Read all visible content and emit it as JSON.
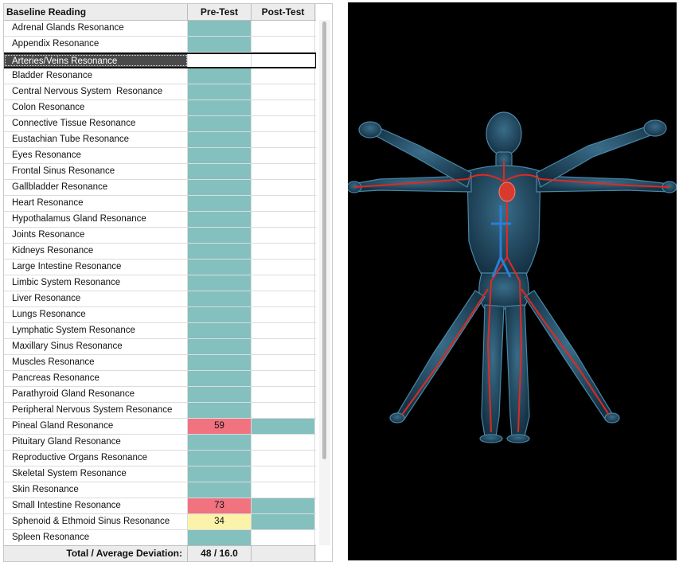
{
  "table": {
    "headers": {
      "name": "Baseline Reading",
      "pre": "Pre-Test",
      "post": "Post-Test"
    },
    "colors": {
      "teal": "#83c0be",
      "red": "#f0737f",
      "yellow": "#fbf3a9",
      "empty": "#ffffff"
    },
    "rows": [
      {
        "name": "Adrenal Glands Resonance",
        "pre": "",
        "pre_color": "teal",
        "post": "",
        "post_color": "empty"
      },
      {
        "name": "Appendix Resonance",
        "pre": "",
        "pre_color": "teal",
        "post": "",
        "post_color": "empty"
      },
      {
        "name": "Arteries/Veins Resonance",
        "pre": "",
        "pre_color": "teal",
        "post": "",
        "post_color": "empty",
        "selected": true
      },
      {
        "name": "Bladder Resonance",
        "pre": "",
        "pre_color": "teal",
        "post": "",
        "post_color": "empty"
      },
      {
        "name": "Central Nervous System  Resonance",
        "pre": "",
        "pre_color": "teal",
        "post": "",
        "post_color": "empty"
      },
      {
        "name": "Colon Resonance",
        "pre": "",
        "pre_color": "teal",
        "post": "",
        "post_color": "empty"
      },
      {
        "name": "Connective Tissue Resonance",
        "pre": "",
        "pre_color": "teal",
        "post": "",
        "post_color": "empty"
      },
      {
        "name": "Eustachian Tube Resonance",
        "pre": "",
        "pre_color": "teal",
        "post": "",
        "post_color": "empty"
      },
      {
        "name": "Eyes Resonance",
        "pre": "",
        "pre_color": "teal",
        "post": "",
        "post_color": "empty"
      },
      {
        "name": "Frontal Sinus Resonance",
        "pre": "",
        "pre_color": "teal",
        "post": "",
        "post_color": "empty"
      },
      {
        "name": "Gallbladder Resonance",
        "pre": "",
        "pre_color": "teal",
        "post": "",
        "post_color": "empty"
      },
      {
        "name": "Heart Resonance",
        "pre": "",
        "pre_color": "teal",
        "post": "",
        "post_color": "empty"
      },
      {
        "name": "Hypothalamus Gland Resonance",
        "pre": "",
        "pre_color": "teal",
        "post": "",
        "post_color": "empty"
      },
      {
        "name": "Joints Resonance",
        "pre": "",
        "pre_color": "teal",
        "post": "",
        "post_color": "empty"
      },
      {
        "name": "Kidneys Resonance",
        "pre": "",
        "pre_color": "teal",
        "post": "",
        "post_color": "empty"
      },
      {
        "name": "Large Intestine Resonance",
        "pre": "",
        "pre_color": "teal",
        "post": "",
        "post_color": "empty"
      },
      {
        "name": "Limbic System Resonance",
        "pre": "",
        "pre_color": "teal",
        "post": "",
        "post_color": "empty"
      },
      {
        "name": "Liver Resonance",
        "pre": "",
        "pre_color": "teal",
        "post": "",
        "post_color": "empty"
      },
      {
        "name": "Lungs Resonance",
        "pre": "",
        "pre_color": "teal",
        "post": "",
        "post_color": "empty"
      },
      {
        "name": "Lymphatic System Resonance",
        "pre": "",
        "pre_color": "teal",
        "post": "",
        "post_color": "empty"
      },
      {
        "name": "Maxillary Sinus Resonance",
        "pre": "",
        "pre_color": "teal",
        "post": "",
        "post_color": "empty"
      },
      {
        "name": "Muscles Resonance",
        "pre": "",
        "pre_color": "teal",
        "post": "",
        "post_color": "empty"
      },
      {
        "name": "Pancreas Resonance",
        "pre": "",
        "pre_color": "teal",
        "post": "",
        "post_color": "empty"
      },
      {
        "name": "Parathyroid Gland Resonance",
        "pre": "",
        "pre_color": "teal",
        "post": "",
        "post_color": "empty"
      },
      {
        "name": "Peripheral Nervous System Resonance",
        "pre": "",
        "pre_color": "teal",
        "post": "",
        "post_color": "empty"
      },
      {
        "name": "Pineal Gland Resonance",
        "pre": "59",
        "pre_color": "red",
        "post": "",
        "post_color": "teal"
      },
      {
        "name": "Pituitary Gland Resonance",
        "pre": "",
        "pre_color": "teal",
        "post": "",
        "post_color": "empty"
      },
      {
        "name": "Reproductive Organs Resonance",
        "pre": "",
        "pre_color": "teal",
        "post": "",
        "post_color": "empty"
      },
      {
        "name": "Skeletal System Resonance",
        "pre": "",
        "pre_color": "teal",
        "post": "",
        "post_color": "empty"
      },
      {
        "name": "Skin Resonance",
        "pre": "",
        "pre_color": "teal",
        "post": "",
        "post_color": "empty"
      },
      {
        "name": "Small Intestine Resonance",
        "pre": "73",
        "pre_color": "red",
        "post": "",
        "post_color": "teal"
      },
      {
        "name": "Sphenoid & Ethmoid Sinus Resonance",
        "pre": "34",
        "pre_color": "yellow",
        "post": "",
        "post_color": "teal"
      },
      {
        "name": "Spleen Resonance",
        "pre": "",
        "pre_color": "teal",
        "post": "",
        "post_color": "empty"
      }
    ],
    "footer": {
      "label": "Total / Average Deviation:",
      "pre": "48 / 16.0",
      "post": ""
    }
  },
  "viewer": {
    "background": "#000000",
    "body_color": "#2a5570",
    "artery_color": "#e02a20",
    "vein_color": "#2a7fd6",
    "icon": "anatomical-figure-image"
  }
}
